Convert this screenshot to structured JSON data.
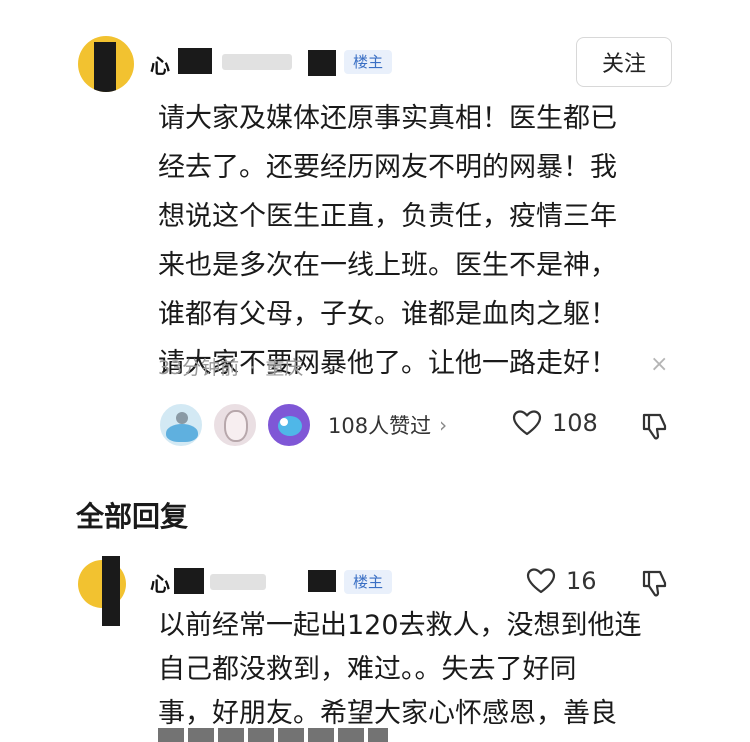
{
  "comment": {
    "username_visible": "心",
    "owner_badge": "楼主",
    "follow_label": "关注",
    "body_lines": [
      "请大家及媒体还原事实真相！医生都已",
      "经去了。还要经历网友不明的网暴！我",
      "想说这个医生正直，负责任，疫情三年",
      "来也是多次在一线上班。医生不是神，",
      "谁都有父母，子女。谁都是血肉之躯！",
      "请大家不要网暴他了。让他一路走好！"
    ],
    "time": "33分钟前",
    "separator": "·",
    "location": "重庆",
    "close_icon": "×",
    "likers_text": "108人赞过",
    "likers_chevron": "›",
    "like_count": "108"
  },
  "replies_section": {
    "title": "全部回复"
  },
  "reply": {
    "username_visible": "心",
    "owner_badge": "楼主",
    "like_count": "16",
    "body_lines": [
      "以前经常一起出120去救人，没想到他连",
      "自己都没救到，难过。。失去了好同",
      "事，好朋友。希望大家心怀感恩，善良"
    ]
  },
  "icons": {
    "heart": "heart-outline-icon",
    "dislike": "thumbs-down-icon",
    "close": "close-icon",
    "chevron": "chevron-right-icon"
  },
  "colors": {
    "badge_text": "#3a6fc4",
    "badge_bg": "#e9f0fb",
    "avatar_yellow": "#f2c230",
    "meta_gray": "#999999"
  }
}
